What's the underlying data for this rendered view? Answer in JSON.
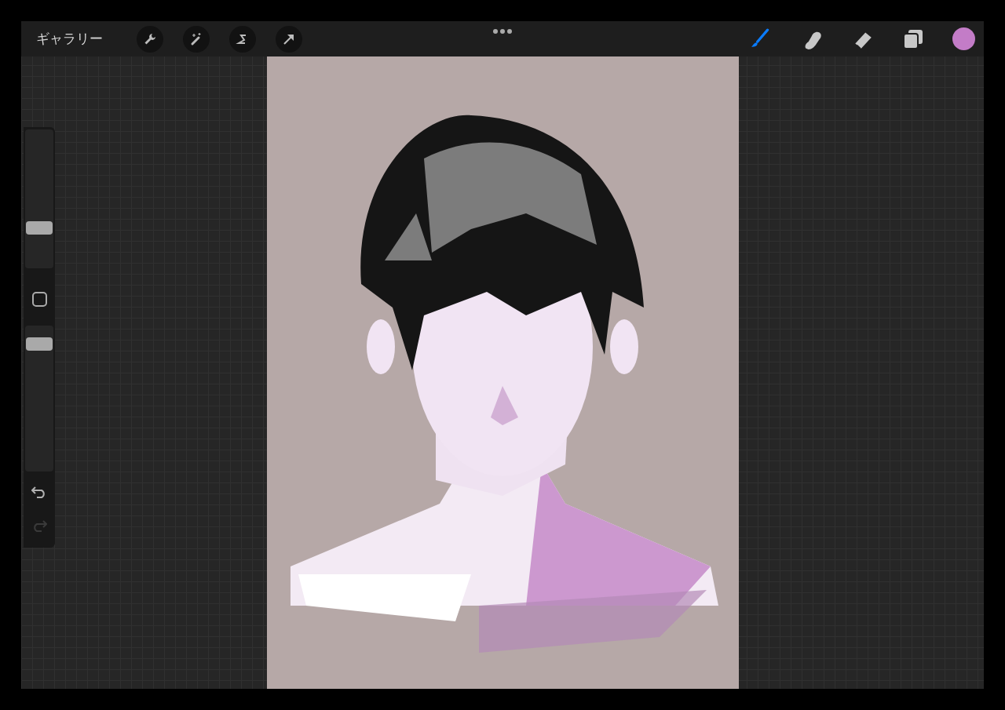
{
  "top_bar": {
    "gallery": "ギャラリー",
    "tools": [
      {
        "kind": "brush",
        "selected": true
      },
      {
        "kind": "smudge",
        "selected": false
      },
      {
        "kind": "eraser",
        "selected": false
      }
    ],
    "color": {
      "color": "#c37cc7"
    }
  },
  "sidebar": {
    "size_slider": {
      "level": 0.27
    },
    "opacity_slider": {
      "level": 0.91
    },
    "undo": {
      "disabled": false
    },
    "redo": {
      "disabled": true
    }
  }
}
